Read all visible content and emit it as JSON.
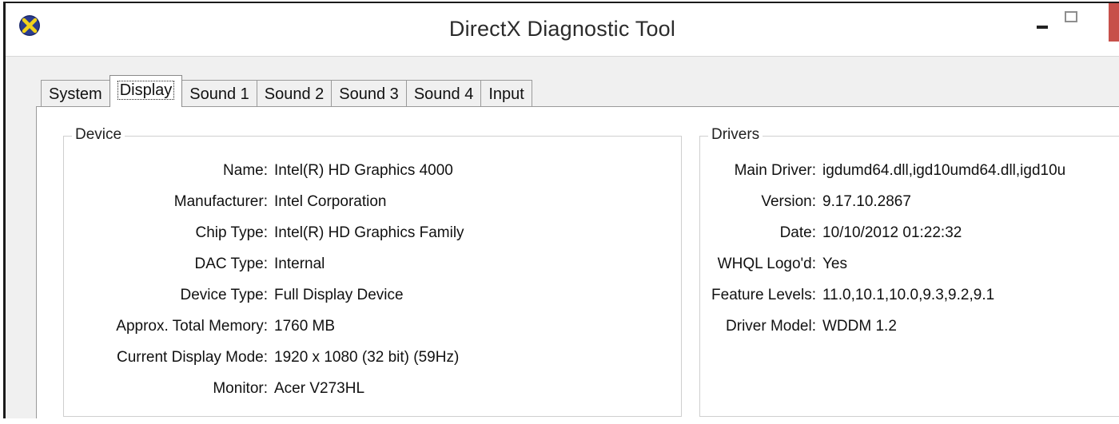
{
  "window": {
    "title": "DirectX Diagnostic Tool"
  },
  "tabs": [
    {
      "label": "System"
    },
    {
      "label": "Display"
    },
    {
      "label": "Sound 1"
    },
    {
      "label": "Sound 2"
    },
    {
      "label": "Sound 3"
    },
    {
      "label": "Sound 4"
    },
    {
      "label": "Input"
    }
  ],
  "active_tab": "Display",
  "device": {
    "legend": "Device",
    "rows": [
      {
        "label": "Name:",
        "value": "Intel(R) HD Graphics 4000"
      },
      {
        "label": "Manufacturer:",
        "value": "Intel Corporation"
      },
      {
        "label": "Chip Type:",
        "value": "Intel(R) HD Graphics Family"
      },
      {
        "label": "DAC Type:",
        "value": "Internal"
      },
      {
        "label": "Device Type:",
        "value": "Full Display Device"
      },
      {
        "label": "Approx. Total Memory:",
        "value": "1760 MB"
      },
      {
        "label": "Current Display Mode:",
        "value": "1920 x 1080 (32 bit) (59Hz)"
      },
      {
        "label": "Monitor:",
        "value": "Acer V273HL"
      }
    ]
  },
  "drivers": {
    "legend": "Drivers",
    "rows": [
      {
        "label": "Main Driver:",
        "value": "igdumd64.dll,igd10umd64.dll,igd10u"
      },
      {
        "label": "Version:",
        "value": "9.17.10.2867"
      },
      {
        "label": "Date:",
        "value": "10/10/2012 01:22:32"
      },
      {
        "label": "WHQL Logo'd:",
        "value": "Yes"
      },
      {
        "label": "Feature Levels:",
        "value": "11.0,10.1,10.0,9.3,9.2,9.1"
      },
      {
        "label": "Driver Model:",
        "value": "WDDM 1.2"
      }
    ]
  },
  "icons": {
    "app": "directx-icon",
    "minimize": "minimize-icon",
    "maximize": "maximize-icon",
    "close": "close-icon"
  },
  "colors": {
    "app_icon_bg": "#1c2a6b",
    "app_icon_x": "#f2d21b",
    "close": "#c7504a"
  }
}
